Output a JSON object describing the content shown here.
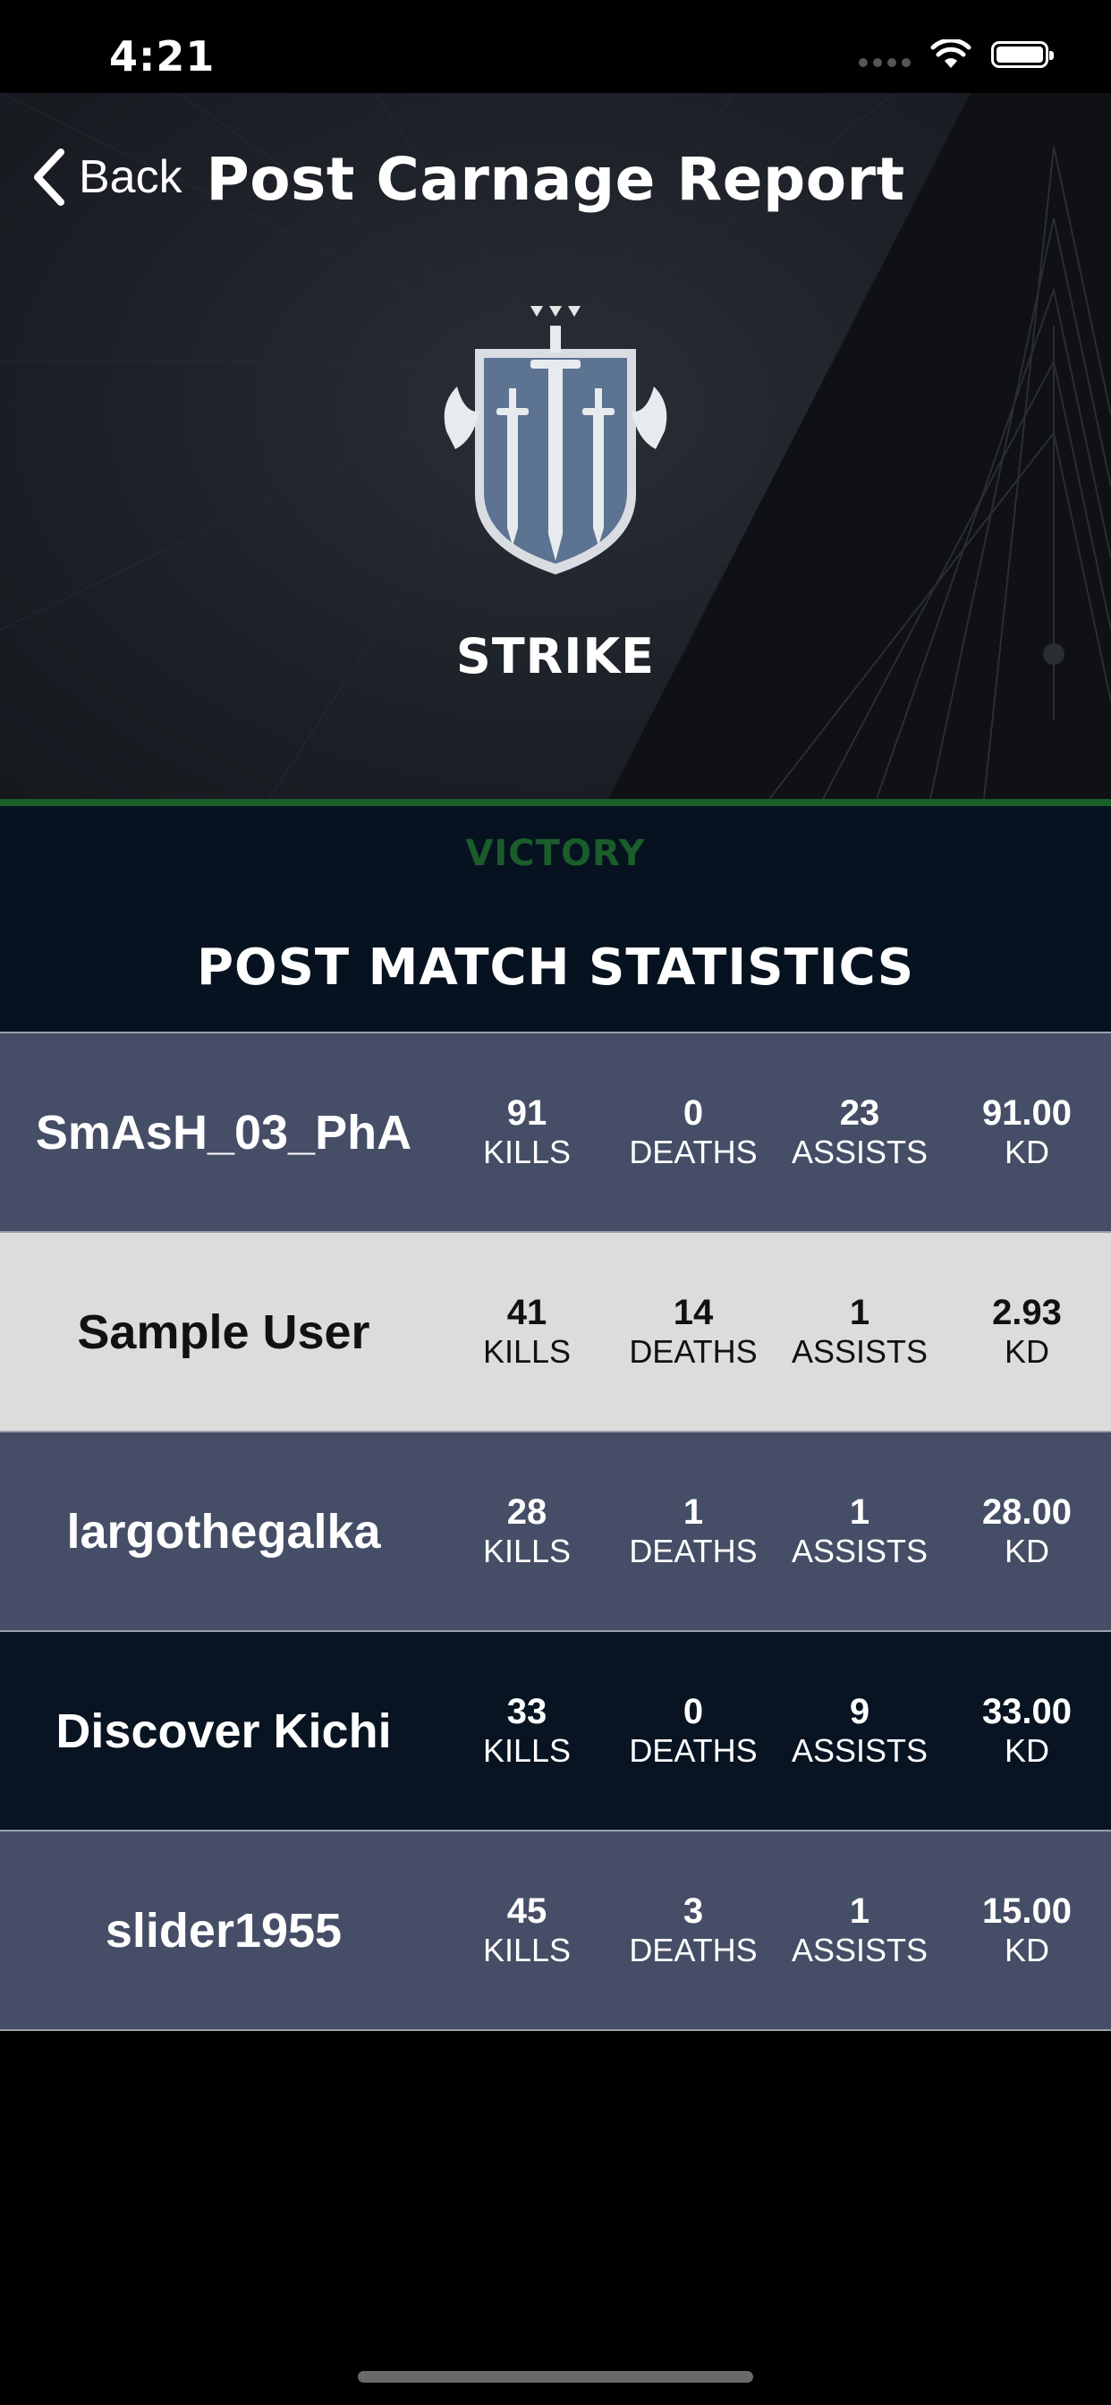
{
  "status_bar": {
    "time": "4:21"
  },
  "nav": {
    "back_label": "Back",
    "title": "Post Carnage Report"
  },
  "activity": {
    "mode": "STRIKE",
    "result": "VICTORY"
  },
  "stats": {
    "heading": "POST MATCH STATISTICS",
    "labels": {
      "kills": "KILLS",
      "deaths": "DEATHS",
      "assists": "ASSISTS",
      "kd": "KD"
    },
    "players": [
      {
        "name": "SmAsH_03_PhA",
        "kills": "91",
        "deaths": "0",
        "assists": "23",
        "kd": "91.00"
      },
      {
        "name": "Sample User",
        "kills": "41",
        "deaths": "14",
        "assists": "1",
        "kd": "2.93"
      },
      {
        "name": "largothegalka",
        "kills": "28",
        "deaths": "1",
        "assists": "1",
        "kd": "28.00"
      },
      {
        "name": "Discover Kichi",
        "kills": "33",
        "deaths": "0",
        "assists": "9",
        "kd": "33.00"
      },
      {
        "name": "slider1955",
        "kills": "45",
        "deaths": "3",
        "assists": "1",
        "kd": "15.00"
      }
    ]
  },
  "colors": {
    "victory_green": "#1a5d2a",
    "row_slate": "#454e66",
    "row_light": "#dcdcdc",
    "row_navy": "#081422",
    "summary_bg": "#061220"
  },
  "icons": {
    "back": "chevron-left-icon",
    "emblem": "strike-emblem-icon",
    "wifi": "wifi-icon",
    "battery": "battery-icon"
  }
}
